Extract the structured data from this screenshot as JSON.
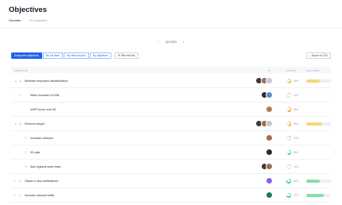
{
  "page": {
    "title": "Objectives"
  },
  "tabs": [
    {
      "label": "Overview",
      "active": true
    },
    {
      "label": "Re-integration",
      "active": false
    }
  ],
  "period": {
    "label": "Q2.2024"
  },
  "filters": {
    "buttons": [
      "Everyone's objectives",
      "My full team",
      "My direct reports",
      "My objectives"
    ],
    "active_index": 0,
    "filter_label": "Filter this list"
  },
  "export": {
    "label": "Export to CSV"
  },
  "table": {
    "headers": {
      "objective": "OBJECTIVE",
      "owner": "PI",
      "status": "STATUS",
      "subtypes": "SUBTYPES"
    },
    "rows": [
      {
        "title": "Minimize employee dissatisfaction",
        "level": 0,
        "expanded": true,
        "expandable": true,
        "icon": "objective-icon",
        "owners": [
          "#3f3a37",
          "#a16b4d",
          "#c4c9d6"
        ],
        "progress": 48,
        "ring_color": "#f59e0b",
        "pct": "48%",
        "bar": {
          "fill": 0.55,
          "color": "#f8d77a"
        }
      },
      {
        "title": "Sales increase of 100k",
        "level": 1,
        "expanded": false,
        "expandable": true,
        "icon": "",
        "owners": [
          "#2c2c2c",
          "#5b8fc7"
        ],
        "progress": 12,
        "ring_color": "#f59e0b",
        "pct": "12%",
        "bar": null
      },
      {
        "title": "eNPS score over 85",
        "level": 1,
        "expanded": false,
        "expandable": false,
        "icon": "",
        "owners": [
          "#b07a5a"
        ],
        "progress": 55,
        "ring_color": "#f59e0b",
        "pct": "55%",
        "bar": null
      },
      {
        "title": "Revenue target",
        "level": 0,
        "expanded": true,
        "expandable": true,
        "icon": "objective-icon",
        "owners": [
          "#3f3a37",
          "#a16b4d",
          "#c4c9d6"
        ],
        "progress": 48,
        "ring_color": "#f59e0b",
        "pct": "48%",
        "bar": {
          "fill": 0.65,
          "color": "#f8d77a"
        }
      },
      {
        "title": "Increase outreach",
        "level": 1,
        "expanded": false,
        "expandable": false,
        "icon": "key-result-icon",
        "owners": [
          "#a86a4a"
        ],
        "progress": 20,
        "ring_color": "#f59e0b",
        "pct": "20%",
        "bar": null
      },
      {
        "title": "50 calls",
        "level": 1,
        "expanded": false,
        "expandable": false,
        "icon": "key-result-icon",
        "owners": [
          "#2c2c2c"
        ],
        "progress": 58,
        "ring_color": "#34d399",
        "pct": "58%",
        "bar": null
      },
      {
        "title": "Add regional sales team",
        "level": 1,
        "expanded": false,
        "expandable": false,
        "icon": "key-result-icon",
        "owners": [
          "#3f3a37",
          "#a16b4d"
        ],
        "progress": 12,
        "ring_color": "#f59e0b",
        "pct": "12%",
        "bar": null
      },
      {
        "title": "Obtain 4 new certifications",
        "level": 0,
        "expanded": false,
        "expandable": true,
        "icon": "objective-icon",
        "owners": [
          "#8b5cf6"
        ],
        "progress": 86,
        "ring_color": "#34d399",
        "pct": "86%",
        "bar": {
          "fill": 0.55,
          "color": "#86e0a6"
        }
      },
      {
        "title": "Increase inbound traffic",
        "level": 0,
        "expanded": false,
        "expandable": true,
        "icon": "objective-icon",
        "owners": [
          "#1f7a5c"
        ],
        "progress": 71,
        "ring_color": "#34d399",
        "pct": "71%",
        "bar": {
          "fill": 0.7,
          "color": "#86e0a6"
        }
      }
    ]
  },
  "colors": {
    "accent": "#2563eb",
    "warning": "#f59e0b",
    "success": "#34d399"
  }
}
